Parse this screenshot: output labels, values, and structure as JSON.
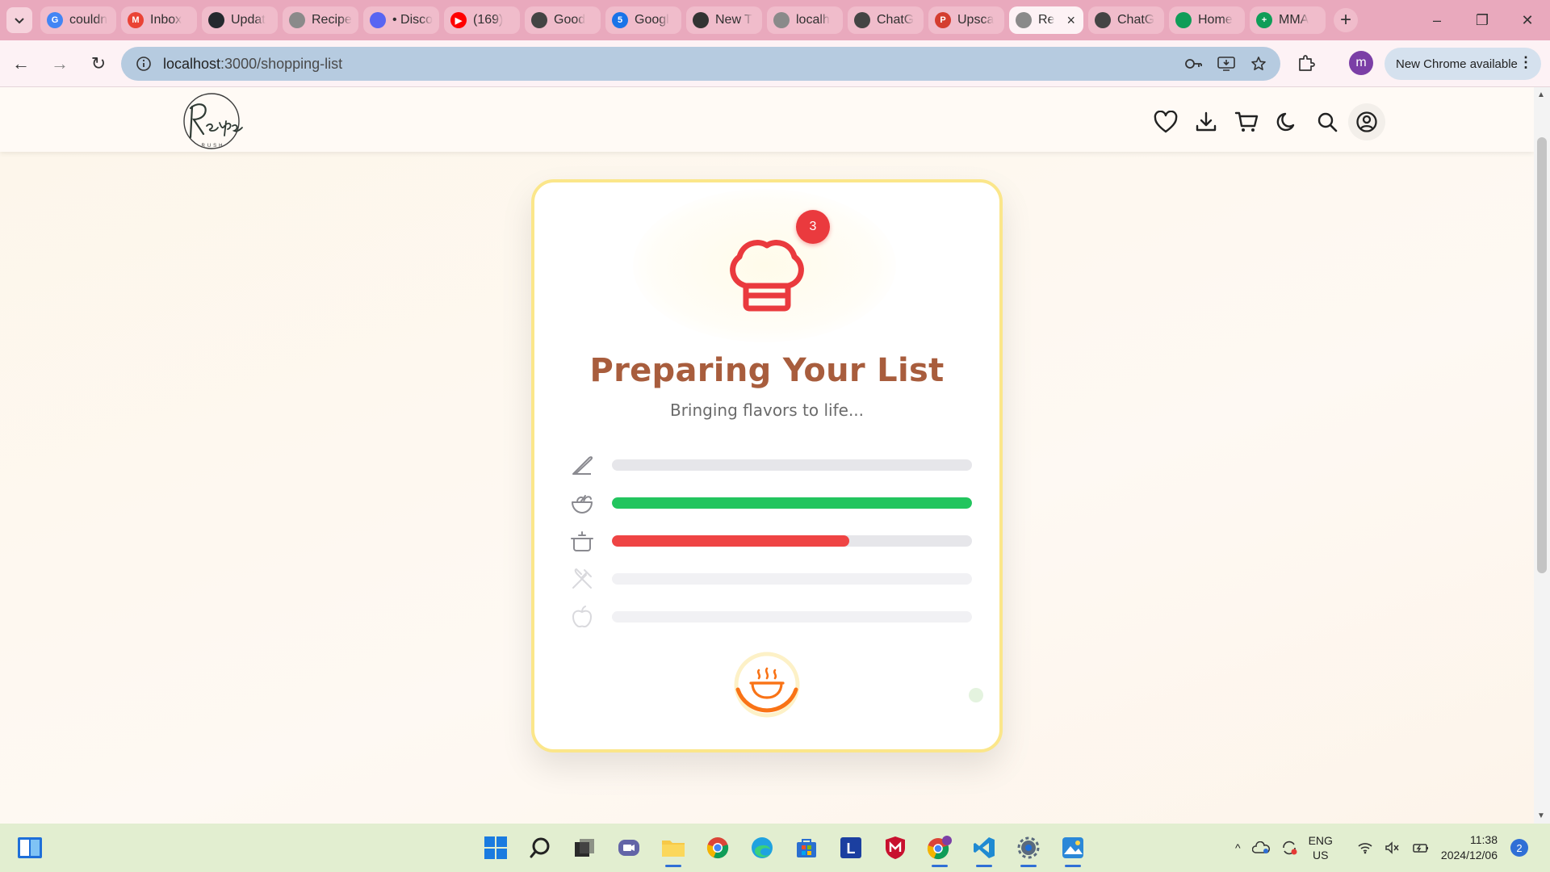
{
  "browser": {
    "tabs": [
      {
        "label": "couldn",
        "fav": "google-icon",
        "color": "#4285f4"
      },
      {
        "label": "Inbox",
        "fav": "gmail-icon",
        "color": "#ea4335"
      },
      {
        "label": "Updat",
        "fav": "github-icon",
        "color": "#24292e"
      },
      {
        "label": "Recipe",
        "fav": "openai-icon",
        "color": "#8a8a8a"
      },
      {
        "label": "• Disco",
        "fav": "discord-icon",
        "color": "#5865f2"
      },
      {
        "label": "(169)",
        "fav": "youtube-icon",
        "color": "#ff0000"
      },
      {
        "label": "Good",
        "fav": "openai-icon",
        "color": "#444444"
      },
      {
        "label": "Googl",
        "fav": "google-calendar-icon",
        "color": "#1a73e8"
      },
      {
        "label": "New T",
        "fav": "chrome-icon",
        "color": "#333333"
      },
      {
        "label": "localh",
        "fav": "globe-icon",
        "color": "#8a8a8a"
      },
      {
        "label": "ChatG",
        "fav": "openai-icon",
        "color": "#444444"
      },
      {
        "label": "Upsca",
        "fav": "p-icon",
        "color": "#d43d2f"
      },
      {
        "label": "Re",
        "fav": "globe-icon",
        "color": "#8a8a8a",
        "active": true
      },
      {
        "label": "ChatG",
        "fav": "openai-icon",
        "color": "#444444"
      },
      {
        "label": "Home",
        "fav": "google-drive-icon",
        "color": "#0f9d58"
      },
      {
        "label": "MMA",
        "fav": "plus-icon",
        "color": "#0f9d58"
      }
    ],
    "url_host": "localhost",
    "url_path": ":3000/shopping-list",
    "update_label": "New Chrome available",
    "profile_initial": "m"
  },
  "page": {
    "title": "Preparing Your List",
    "subtitle": "Bringing flavors to life...",
    "notification_count": "3",
    "steps": [
      {
        "icon": "knife-icon",
        "progress": 0,
        "color": "#22c55e",
        "faint": false
      },
      {
        "icon": "salad-bowl-icon",
        "progress": 1.0,
        "color": "#22c55e",
        "faint": false
      },
      {
        "icon": "cooking-pot-icon",
        "progress": 0.66,
        "color": "#ef4444",
        "faint": false
      },
      {
        "icon": "utensils-crossed-icon",
        "progress": 0,
        "color": "#22c55e",
        "faint": true
      },
      {
        "icon": "apple-icon",
        "progress": 0,
        "color": "#22c55e",
        "faint": true
      }
    ],
    "colors": {
      "accent_red": "#ea3a3e",
      "title_brown": "#a85d3d",
      "card_border": "#fbe68a",
      "bowl_orange": "#f97316"
    }
  },
  "taskbar": {
    "lang_top": "ENG",
    "lang_bottom": "US",
    "time": "11:38",
    "date": "2024/12/06",
    "notifications": "2"
  }
}
